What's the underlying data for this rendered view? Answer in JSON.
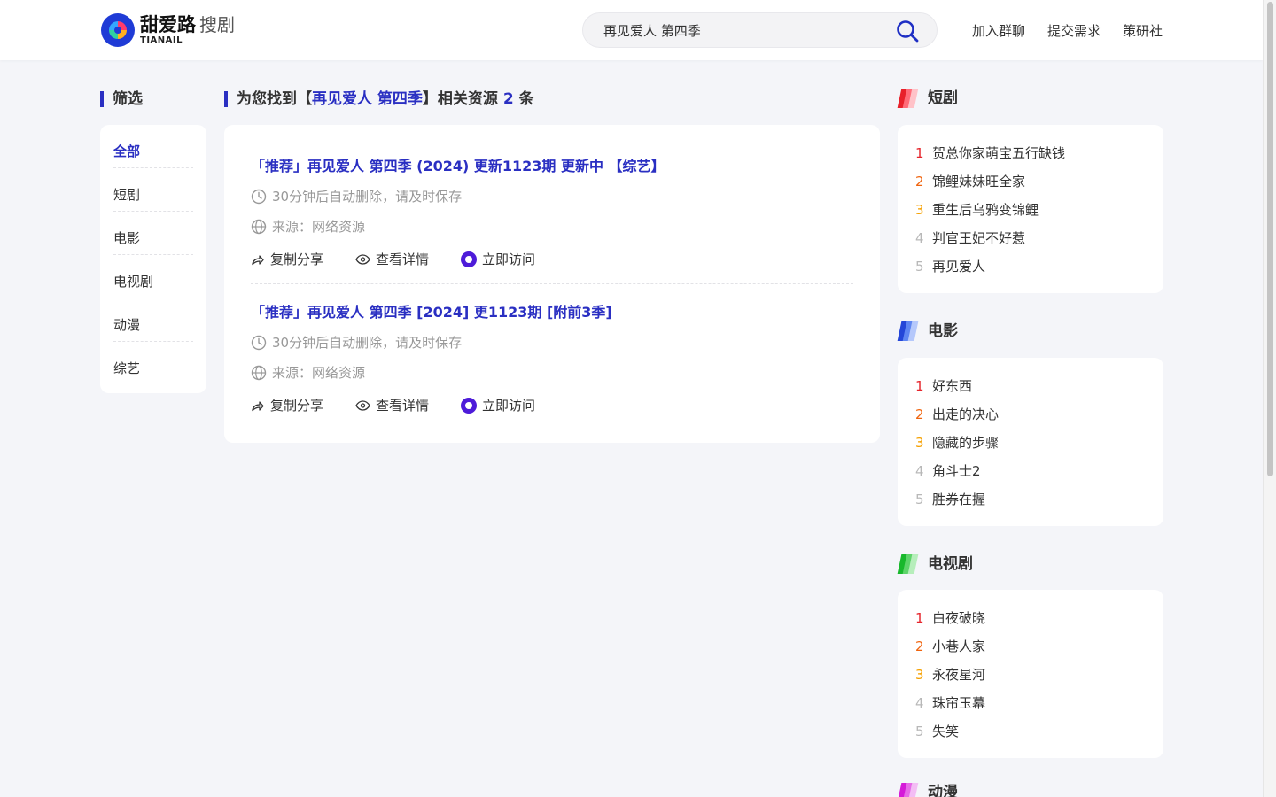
{
  "header": {
    "logo": {
      "brand": "甜爱路",
      "sub": "搜剧",
      "en": "TIANAIL"
    },
    "search": {
      "value": "再见爱人 第四季",
      "placeholder": ""
    },
    "nav": [
      {
        "label": "加入群聊"
      },
      {
        "label": "提交需求"
      },
      {
        "label": "策研社"
      }
    ]
  },
  "filter": {
    "title": "筛选",
    "items": [
      {
        "label": "全部",
        "active": true
      },
      {
        "label": "短剧"
      },
      {
        "label": "电影"
      },
      {
        "label": "电视剧"
      },
      {
        "label": "动漫"
      },
      {
        "label": "综艺"
      }
    ]
  },
  "results": {
    "prefix": "为您找到【",
    "query": "再见爱人 第四季",
    "middle": "】相关资源 ",
    "count": "2",
    "suffix": " 条",
    "items": [
      {
        "title": "「推荐」再见爱人 第四季 (2024) 更新1123期 更新中 【综艺】",
        "expire": "30分钟后自动删除，请及时保存",
        "source": "来源：网络资源",
        "share": "复制分享",
        "detail": "查看详情",
        "visit": "立即访问"
      },
      {
        "title": "「推荐」再见爱人 第四季 [2024] 更1123期 [附前3季]",
        "expire": "30分钟后自动删除，请及时保存",
        "source": "来源：网络资源",
        "share": "复制分享",
        "detail": "查看详情",
        "visit": "立即访问"
      }
    ]
  },
  "rankings": [
    {
      "title": "短剧",
      "colors": [
        "#e8202a",
        "#ff6b78",
        "#ffc2c8"
      ],
      "items": [
        "贺总你家萌宝五行缺钱",
        "锦鲤妹妹旺全家",
        "重生后乌鸦变锦鲤",
        "判官王妃不好惹",
        "再见爱人"
      ]
    },
    {
      "title": "电影",
      "colors": [
        "#2446d8",
        "#5f86f2",
        "#b5c8fb"
      ],
      "items": [
        "好东西",
        "出走的决心",
        "隐藏的步骤",
        "角斗士2",
        "胜券在握"
      ]
    },
    {
      "title": "电视剧",
      "colors": [
        "#18b82c",
        "#5ed46a",
        "#b6eebb"
      ],
      "items": [
        "白夜破晓",
        "小巷人家",
        "永夜星河",
        "珠帘玉幕",
        "失笑"
      ]
    },
    {
      "title": "动漫",
      "colors": [
        "#d51ad8",
        "#e66be8",
        "#f3bdf4"
      ],
      "items": []
    }
  ]
}
